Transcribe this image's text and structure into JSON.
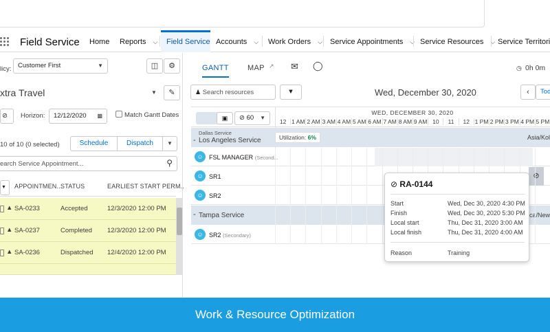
{
  "app": {
    "title": "Field Service"
  },
  "nav": {
    "items": [
      {
        "label": "Home",
        "chevron": false
      },
      {
        "label": "Reports",
        "chevron": true
      },
      {
        "label": "Field Service",
        "chevron": false,
        "active": true
      },
      {
        "label": "Accounts",
        "chevron": true
      },
      {
        "label": "Work Orders",
        "chevron": true
      },
      {
        "label": "Service Appointments",
        "chevron": true
      },
      {
        "label": "Service Resources",
        "chevron": true
      },
      {
        "label": "Service Territories",
        "chevron": false
      }
    ]
  },
  "left": {
    "policy_label": "licy:",
    "policy_value": "Customer First",
    "filter_title": "xtra Travel",
    "horizon_label": "Horizon:",
    "horizon_value": "12/12/2020",
    "match_gantt_label": "Match Gantt Dates",
    "count_text": "10 of 10 (0 selected)",
    "schedule_label": "Schedule",
    "dispatch_label": "Dispatch",
    "search_placeholder": "earch Service Appointment...",
    "columns": [
      "APPOINTMEN...",
      "STATUS",
      "EARLIEST START PERM..."
    ],
    "rows": [
      {
        "id": "SA-0233",
        "status": "Accepted",
        "start": "12/3/2020 12:00 PM"
      },
      {
        "id": "SA-0237",
        "status": "Completed",
        "start": "12/3/2020 12:00 PM"
      },
      {
        "id": "SA-0236",
        "status": "Dispatched",
        "start": "12/4/2020 12:00 PM"
      }
    ]
  },
  "right": {
    "tabs": {
      "gantt": "GANTT",
      "map": "MAP"
    },
    "time_readout": "0h 0m",
    "search_resources_placeholder": "Search resources",
    "date_title": "Wed, December 30, 2020",
    "today_label": "Tod",
    "zoom_value": "60",
    "day_header": "WED, DECEMBER 30, 2020",
    "hours": [
      "12",
      "1 AM",
      "2 AM",
      "3 AM",
      "4 AM",
      "5 AM",
      "6 AM",
      "7 AM",
      "8 AM",
      "9 AM",
      "10",
      "11",
      "12",
      "1 PM",
      "2 PM",
      "3 PM",
      "4 PM",
      "5 PM"
    ],
    "groups": [
      {
        "parent": "Dallas Service",
        "name": "Los Angeles Service",
        "utilization_label": "Utilization:",
        "utilization_value": "6%",
        "tz": "Asia/Kol"
      },
      {
        "name": "Tampa Service",
        "tz": "ca/New"
      }
    ],
    "resources": [
      {
        "name": "FSL MANAGER",
        "sub": "(Second..."
      },
      {
        "name": "SR1",
        "sub": ""
      },
      {
        "name": "SR2",
        "sub": ""
      },
      {
        "name": "SR2",
        "sub": "(Secondary)"
      }
    ]
  },
  "tooltip": {
    "title": "RA-0144",
    "fields": [
      {
        "k": "Start",
        "v": "Wed, Dec 30, 2020 4:30 PM"
      },
      {
        "k": "Finish",
        "v": "Wed, Dec 30, 2020 5:30 PM"
      },
      {
        "k": "Local start",
        "v": "Thu, Dec 31, 2020 3:00 AM"
      },
      {
        "k": "Local finish",
        "v": "Thu, Dec 31, 2020 4:00 AM"
      }
    ],
    "reason_label": "Reason",
    "reason_value": "Training"
  },
  "footer": {
    "caption": "Work & Resource Optimization"
  },
  "colors": {
    "accent": "#0070d2",
    "footer": "#1b9de2",
    "row_highlight": "#f6f9c4",
    "utilization": "#04844b"
  }
}
